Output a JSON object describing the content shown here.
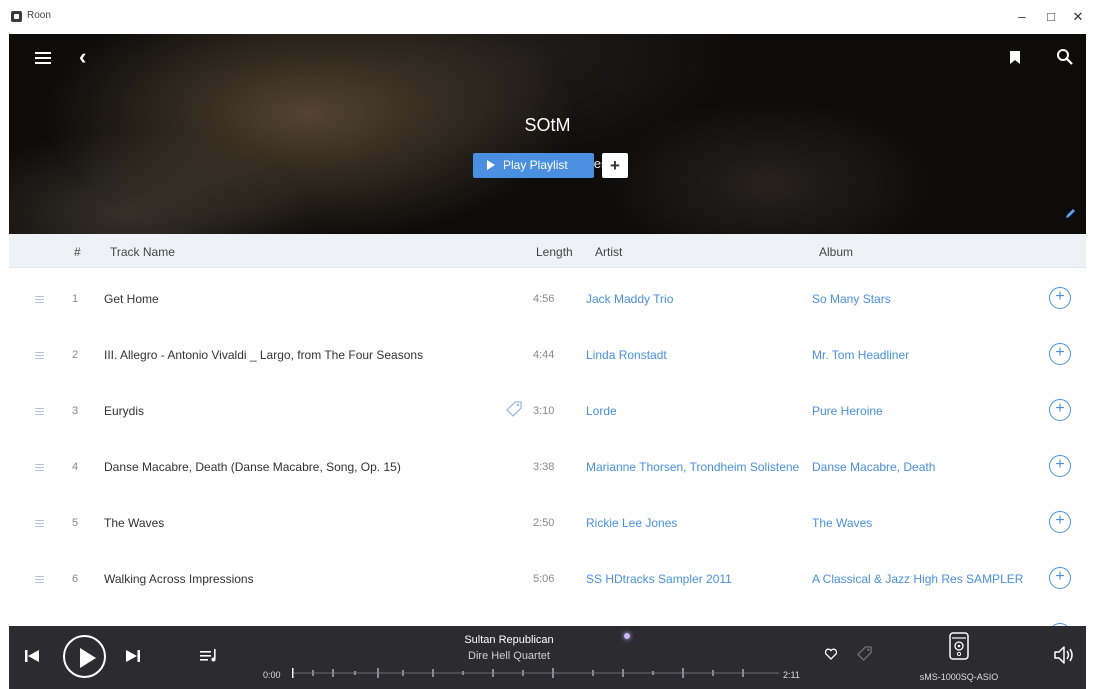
{
  "window": {
    "app_title": "Roon",
    "minimize": "–",
    "maximize": "□",
    "close": "✕"
  },
  "hero": {
    "title": "SOtM",
    "subtitle": "7 Tracks, 33 minutes",
    "play_label": "Play Playlist",
    "add_label": "+"
  },
  "table": {
    "headers": {
      "num": "#",
      "name": "Track Name",
      "length": "Length",
      "artist": "Artist",
      "album": "Album"
    },
    "rows": [
      {
        "num": "1",
        "name": "Get Home",
        "length": "4:56",
        "artist": "Jack Maddy Trio",
        "album": "So Many Stars",
        "tagged": false
      },
      {
        "num": "2",
        "name": "III. Allegro - Antonio Vivaldi _ Largo, from The Four Seasons",
        "length": "4:44",
        "artist": "Linda Ronstadt",
        "album": "Mr. Tom Headliner",
        "tagged": false
      },
      {
        "num": "3",
        "name": "Eurydis",
        "length": "3:10",
        "artist": "Lorde",
        "album": "Pure Heroine",
        "tagged": true
      },
      {
        "num": "4",
        "name": "Danse Macabre, Death (Danse Macabre, Song, Op. 15)",
        "length": "3:38",
        "artist": "Marianne Thorsen, Trondheim Solistene",
        "album": "Danse Macabre, Death",
        "tagged": false
      },
      {
        "num": "5",
        "name": "The Waves",
        "length": "2:50",
        "artist": "Rickie Lee Jones",
        "album": "The Waves",
        "tagged": false
      },
      {
        "num": "6",
        "name": "Walking Across Impressions",
        "length": "5:06",
        "artist": "SS HDtracks Sampler 2011",
        "album": "A Classical & Jazz High Res SAMPLER",
        "tagged": false
      }
    ]
  },
  "player": {
    "track": "Sultan Republican",
    "artist": "Dire Hell Quartet",
    "time_start": "0:00",
    "time_end": "2:11",
    "zone": "sMS-1000SQ-ASIO"
  },
  "icons": {
    "menu": "hamburger-icon",
    "back": "back-arrow-icon",
    "bookmark": "bookmark-icon",
    "search": "search-icon",
    "edit": "pencil-icon",
    "row_handle": "drag-handle-icon",
    "row_add": "plus-circle-icon",
    "tag": "tag-icon",
    "prev": "skip-previous-icon",
    "play": "play-icon",
    "next": "skip-next-icon",
    "queue": "queue-icon",
    "heart": "heart-icon",
    "speaker": "speaker-icon",
    "volume": "volume-icon"
  },
  "colors": {
    "accent": "#4a8fe0",
    "player_bg": "#2c2c30",
    "header_bg": "#eef2f6"
  }
}
